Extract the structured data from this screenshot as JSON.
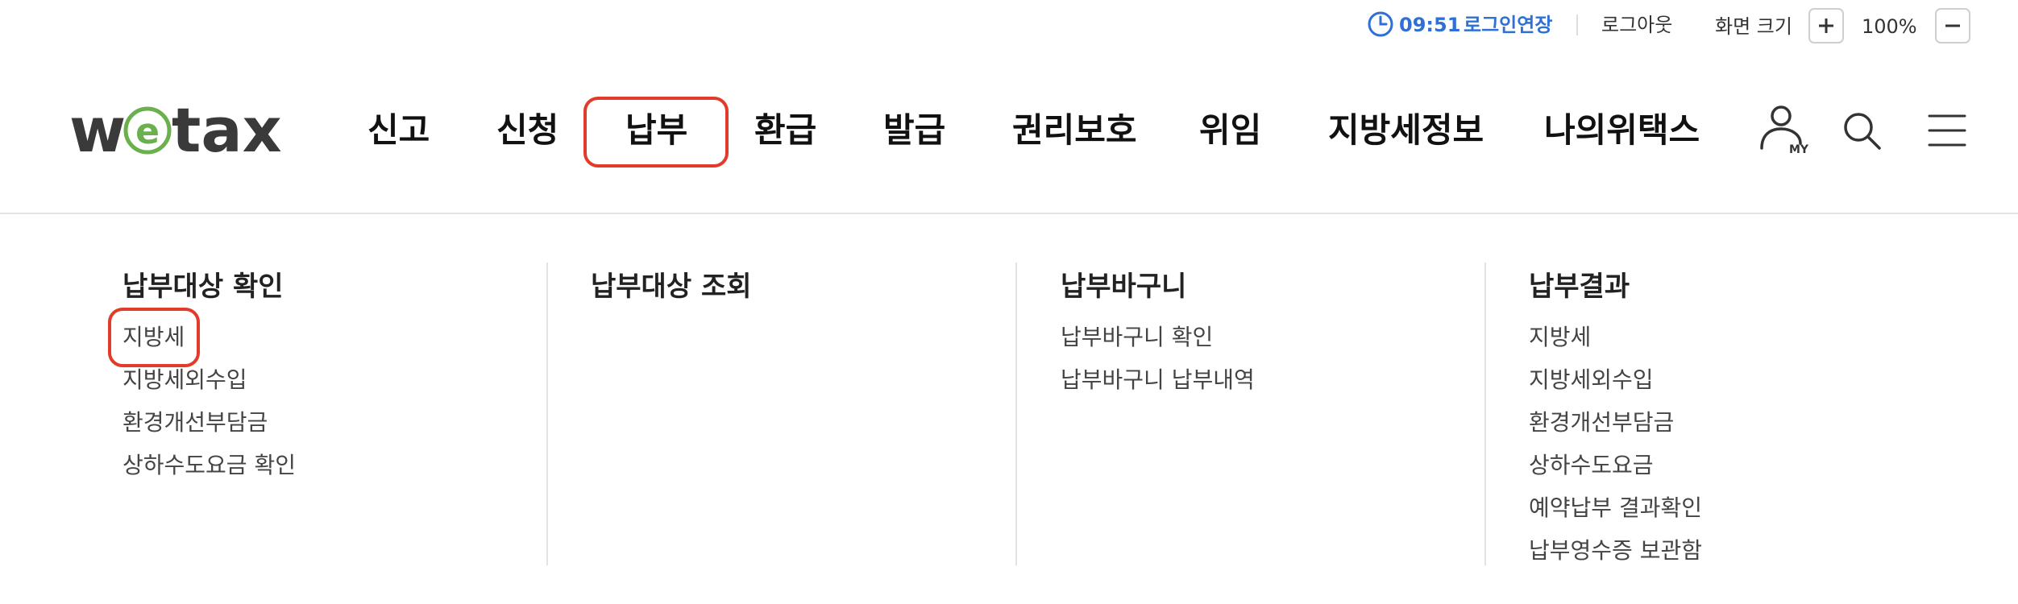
{
  "utility": {
    "time": "09:51",
    "extend_login": "로그인연장",
    "logout": "로그아웃",
    "zoom_label": "화면 크기",
    "zoom_value": "100%"
  },
  "logo": {
    "text": "wetax"
  },
  "nav": [
    "신고",
    "신청",
    "납부",
    "환급",
    "발급",
    "권리보호",
    "위임",
    "지방세정보",
    "나의위택스"
  ],
  "header_icons": {
    "my_label": "MY"
  },
  "menu": {
    "columns": [
      {
        "title": "납부대상 확인",
        "items": [
          "지방세",
          "지방세외수입",
          "환경개선부담금",
          "상하수도요금 확인"
        ]
      },
      {
        "title": "납부대상 조회",
        "items": []
      },
      {
        "title": "납부바구니",
        "items": [
          "납부바구니 확인",
          "납부바구니 납부내역"
        ]
      },
      {
        "title": "납부결과",
        "items": [
          "지방세",
          "지방세외수입",
          "환경개선부담금",
          "상하수도요금",
          "예약납부 결과확인",
          "납부영수증 보관함"
        ]
      }
    ]
  },
  "colors": {
    "accent_blue": "#2f6fd6",
    "highlight_red": "#e23b2a",
    "logo_green": "#6ab04c"
  }
}
